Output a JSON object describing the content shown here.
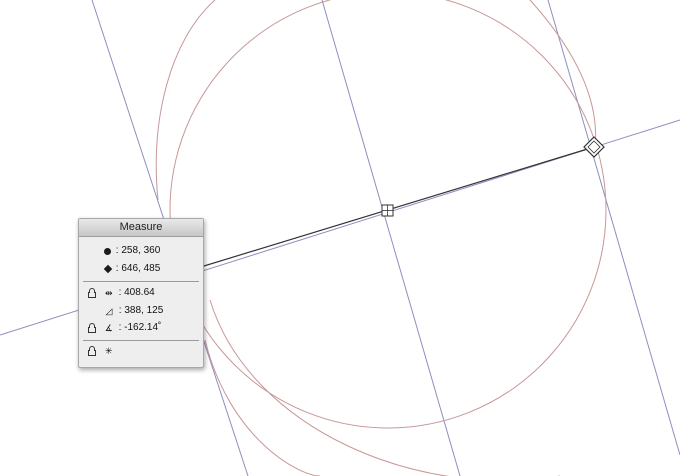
{
  "panel": {
    "title": "Measure",
    "start_point": {
      "icon": "filled-circle-icon",
      "value": ": 258, 360"
    },
    "end_point": {
      "icon": "filled-diamond-icon",
      "value": ": 646, 485"
    },
    "distance": {
      "lock_icon": "lock-icon",
      "icon": "distance-icon",
      "value": ": 408.64"
    },
    "delta": {
      "icon": "delta-triangle-icon",
      "value": ": 388, 125"
    },
    "angle": {
      "lock_icon": "lock-icon",
      "icon": "angle-icon",
      "value": ": -162.14˚"
    },
    "snap": {
      "lock_icon": "lock-icon",
      "icon": "snap-center-icon"
    }
  },
  "colors": {
    "circle_stroke": "#c79797",
    "guide_stroke": "#8e8ec0",
    "measure_line": "#333333"
  }
}
